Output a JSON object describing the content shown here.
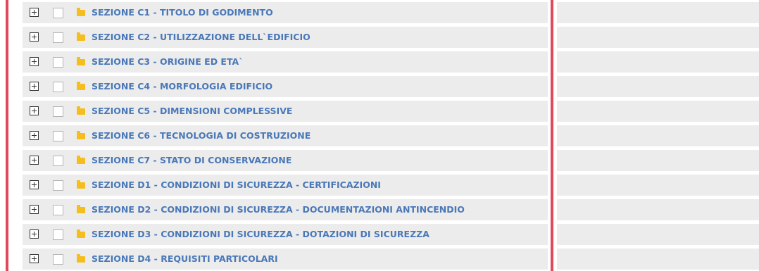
{
  "colors": {
    "accent_red": "#e0495b",
    "row_background": "#ececec",
    "label_blue": "#4a78b8",
    "folder_yellow": "#f5be1d"
  },
  "tree": {
    "items": [
      {
        "label": "SEZIONE C1 - TITOLO DI GODIMENTO",
        "icon": "folder-icon"
      },
      {
        "label": "SEZIONE C2 - UTILIZZAZIONE DELL`EDIFICIO",
        "icon": "folder-icon"
      },
      {
        "label": "SEZIONE C3 - ORIGINE ED ETA`",
        "icon": "folder-icon"
      },
      {
        "label": "SEZIONE C4 - MORFOLOGIA EDIFICIO",
        "icon": "folder-icon"
      },
      {
        "label": "SEZIONE C5 - DIMENSIONI COMPLESSIVE",
        "icon": "folder-icon"
      },
      {
        "label": "SEZIONE C6 - TECNOLOGIA DI COSTRUZIONE",
        "icon": "folder-icon"
      },
      {
        "label": "SEZIONE C7 - STATO DI CONSERVAZIONE",
        "icon": "folder-icon"
      },
      {
        "label": "SEZIONE D1 - CONDIZIONI DI SICUREZZA - CERTIFICAZIONI",
        "icon": "folder-icon"
      },
      {
        "label": "SEZIONE D2 - CONDIZIONI DI SICUREZZA - DOCUMENTAZIONI ANTINCENDIO",
        "icon": "folder-icon"
      },
      {
        "label": "SEZIONE D3 - CONDIZIONI DI SICUREZZA - DOTAZIONI DI SICUREZZA",
        "icon": "folder-icon"
      },
      {
        "label": "SEZIONE D4 - REQUISITI PARTICOLARI",
        "icon": "folder-icon"
      }
    ]
  }
}
